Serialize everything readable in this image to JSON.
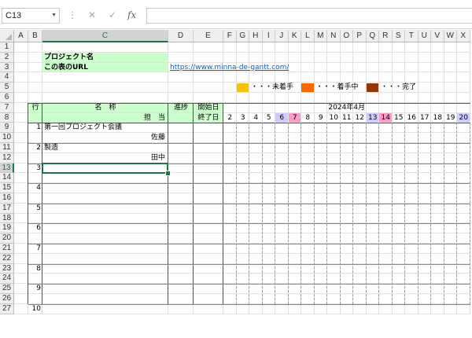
{
  "formula_bar": {
    "name_box": "C13",
    "icons": [
      "more-icon",
      "cancel-icon",
      "enter-icon",
      "function-icon"
    ],
    "cancel_glyph": "✕",
    "enter_glyph": "✓",
    "fx_glyph": "fx",
    "more_glyph": "⋮",
    "formula": ""
  },
  "columns": [
    "A",
    "B",
    "C",
    "D",
    "E",
    "F",
    "G",
    "H",
    "I",
    "J",
    "K",
    "L",
    "M",
    "N",
    "O",
    "P",
    "Q",
    "R",
    "S",
    "T",
    "U",
    "V",
    "W",
    "X"
  ],
  "rows": [
    "1",
    "2",
    "3",
    "4",
    "5",
    "6",
    "7",
    "8",
    "9",
    "10",
    "11",
    "12",
    "13",
    "14",
    "15",
    "16",
    "17",
    "18",
    "19",
    "20",
    "21",
    "22",
    "23",
    "24",
    "25",
    "26",
    "27"
  ],
  "selected": {
    "column": "C",
    "row": "13"
  },
  "sheet": {
    "project_name_label": "プロジェクト名",
    "url_label": "この表のURL",
    "url": "https://www.minna-de-gantt.com/",
    "legend": [
      {
        "color": "#ffc000",
        "label": "・・・未着手"
      },
      {
        "color": "#ff6600",
        "label": "・・・着手中"
      },
      {
        "color": "#993300",
        "label": "・・・完了"
      }
    ],
    "header": {
      "row_no": "行",
      "name": "名　称",
      "owner": "担　当",
      "progress": "進捗",
      "start": "開始日",
      "end": "終了日",
      "month": "2024年4月",
      "days": [
        "2",
        "3",
        "4",
        "5",
        "6",
        "7",
        "8",
        "9",
        "10",
        "11",
        "12",
        "13",
        "14",
        "15",
        "16",
        "17",
        "18",
        "19",
        "20"
      ]
    },
    "tasks": [
      {
        "no": "1",
        "name": "第一回プロジェクト会議",
        "owner": "佐藤"
      },
      {
        "no": "2",
        "name": "製造",
        "owner": "田中"
      },
      {
        "no": "3",
        "name": "",
        "owner": ""
      },
      {
        "no": "4",
        "name": "",
        "owner": ""
      },
      {
        "no": "5",
        "name": "",
        "owner": ""
      },
      {
        "no": "6",
        "name": "",
        "owner": ""
      },
      {
        "no": "7",
        "name": "",
        "owner": ""
      },
      {
        "no": "8",
        "name": "",
        "owner": ""
      },
      {
        "no": "9",
        "name": "",
        "owner": ""
      },
      {
        "no": "10",
        "name": "",
        "owner": ""
      }
    ]
  },
  "colors": {
    "header_green": "#ccffcc",
    "saturday_blue": "#ccccff",
    "sunday_pink": "#ff99cc",
    "selection_green": "#217346"
  },
  "weekend_days": {
    "saturday": [
      "6",
      "13",
      "20"
    ],
    "sunday": [
      "7",
      "14"
    ]
  }
}
